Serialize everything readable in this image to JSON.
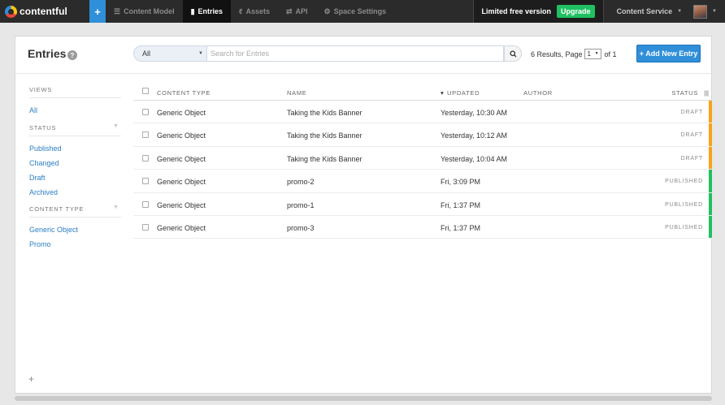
{
  "nav": {
    "logo": "contentful",
    "add": "+",
    "tabs": [
      {
        "label": "Content Model",
        "icon": "database-icon"
      },
      {
        "label": "Entries",
        "icon": "document-icon"
      },
      {
        "label": "Assets",
        "icon": "paperclip-icon"
      },
      {
        "label": "API",
        "icon": "shuffle-icon"
      },
      {
        "label": "Space Settings",
        "icon": "gear-icon"
      }
    ],
    "active_tab": "Entries",
    "plan": "Limited free version",
    "upgrade": "Upgrade",
    "space": "Content Service"
  },
  "header": {
    "title": "Entries",
    "help": "?",
    "filter": "All",
    "search_placeholder": "Search for Entries",
    "pager": {
      "results": "6 Results, Page",
      "page": "1",
      "of": "of 1"
    },
    "add_button": "+ Add New Entry"
  },
  "sidebar": {
    "views_heading": "VIEWS",
    "all": "All",
    "status_heading": "STATUS",
    "statuses": [
      "Published",
      "Changed",
      "Draft",
      "Archived"
    ],
    "content_type_heading": "CONTENT TYPE",
    "content_types": [
      "Generic Object",
      "Promo"
    ],
    "add": "+"
  },
  "table": {
    "columns": {
      "content_type": "CONTENT TYPE",
      "name": "NAME",
      "updated": "UPDATED",
      "author": "AUTHOR",
      "status": "STATUS"
    },
    "rows": [
      {
        "type": "Generic Object",
        "name": "Taking the Kids Banner",
        "updated": "Yesterday, 10:30 AM",
        "status": "DRAFT"
      },
      {
        "type": "Generic Object",
        "name": "Taking the Kids Banner",
        "updated": "Yesterday, 10:12 AM",
        "status": "DRAFT"
      },
      {
        "type": "Generic Object",
        "name": "Taking the Kids Banner",
        "updated": "Yesterday, 10:04 AM",
        "status": "DRAFT"
      },
      {
        "type": "Generic Object",
        "name": "promo-2",
        "updated": "Fri, 3:09 PM",
        "status": "PUBLISHED"
      },
      {
        "type": "Generic Object",
        "name": "promo-1",
        "updated": "Fri, 1:37 PM",
        "status": "PUBLISHED"
      },
      {
        "type": "Generic Object",
        "name": "promo-3",
        "updated": "Fri, 1:37 PM",
        "status": "PUBLISHED"
      }
    ]
  },
  "colors": {
    "accent": "#2f8fd8",
    "draft": "#f6a418",
    "published": "#1fbf62",
    "nav_bg": "#2b2b2b"
  }
}
